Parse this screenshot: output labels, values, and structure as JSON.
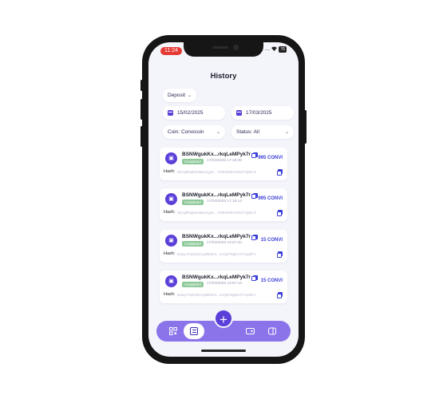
{
  "status_bar": {
    "time": "11:24",
    "dots": "....",
    "wifi": "wifi-icon",
    "battery": "76"
  },
  "header": {
    "title": "History"
  },
  "filters": {
    "type": "Deposit",
    "start_date": "15/02/2025",
    "end_date": "17/03/2025",
    "coin": "Coin: Convicoin",
    "status": "Status: All"
  },
  "transactions": [
    {
      "address": "BSNWgukKx...rkqLeMPyk7r",
      "status": "Completed",
      "date": "17/03/2025 17:18:36",
      "amount": "995 CONVI",
      "hash_label": "Hash:",
      "hash": "4EcqBNqbxNBwxzyyK...7K9KWdmrSRZYQBCX"
    },
    {
      "address": "BSNWgukKx...rkqLeMPyk7r",
      "status": "Completed",
      "date": "17/03/2025 17:18:13",
      "amount": "995 CONVI",
      "hash_label": "Hash:",
      "hash": "4EcqBNqbxNBwxzyyK...7K9KWdmrSRZYQBCX"
    },
    {
      "address": "BSNWgukKx...rkqLeMPyk7r",
      "status": "Completed",
      "date": "17/03/2025 13:57:34",
      "amount": "15 CONVI",
      "hash_label": "Hash:",
      "hash": "5wayYCEpW1Cp6k6zm...xAQeF8g5VcFVqvkFv"
    },
    {
      "address": "BSNWgukKx...rkqLeMPyk7r",
      "status": "Completed",
      "date": "17/03/2025 13:57:14",
      "amount": "15 CONVI",
      "hash_label": "Hash:",
      "hash": "5wayYCEpW1Cp6k6zm...xAQeF8g5VcFVqvkFv"
    }
  ],
  "nav": {
    "fab": "+",
    "items": [
      "qr-code-icon",
      "list-icon",
      "wallet-icon",
      "card-icon"
    ],
    "active": "list-icon"
  },
  "colors": {
    "accent": "#5b3fd9",
    "navbar": "#8b73ea",
    "amount": "#3b3fd9",
    "badge": "#8fc99a",
    "time_pill": "#e53935"
  }
}
